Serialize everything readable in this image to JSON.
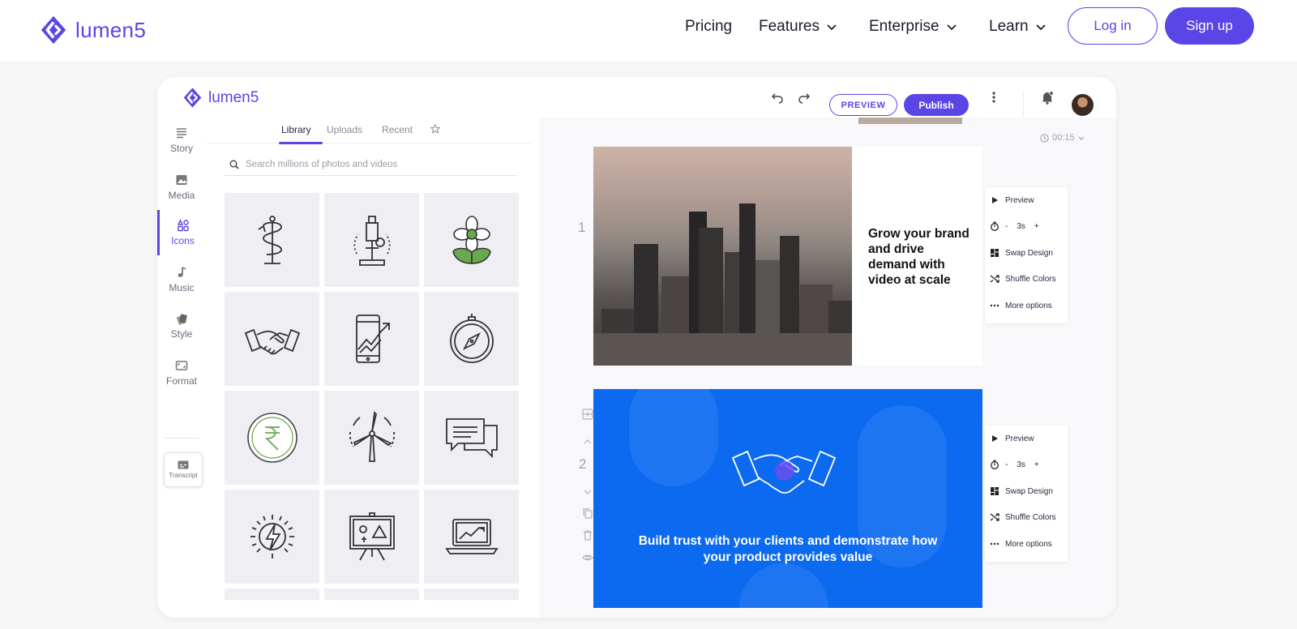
{
  "site": {
    "logo_text": "lumen5",
    "nav": [
      {
        "label": "Pricing",
        "has_dropdown": false
      },
      {
        "label": "Features",
        "has_dropdown": true
      },
      {
        "label": "Enterprise",
        "has_dropdown": true
      },
      {
        "label": "Learn",
        "has_dropdown": true
      }
    ],
    "login_label": "Log in",
    "signup_label": "Sign up",
    "accent_color": "#5a46e6"
  },
  "app": {
    "logo_text": "lumen5",
    "toolbar": {
      "undo_icon": "undo-icon",
      "redo_icon": "redo-icon",
      "preview_label": "PREVIEW",
      "publish_label": "Publish",
      "more_icon": "kebab-menu-icon",
      "notification_icon": "bell-icon"
    },
    "rail": [
      {
        "label": "Story",
        "icon": "lines-icon",
        "active": false
      },
      {
        "label": "Media",
        "icon": "image-icon",
        "active": false
      },
      {
        "label": "Icons",
        "icon": "shapes-icon",
        "active": true
      },
      {
        "label": "Music",
        "icon": "music-note-icon",
        "active": false
      },
      {
        "label": "Style",
        "icon": "palette-icon",
        "active": false
      },
      {
        "label": "Format",
        "icon": "aspect-ratio-icon",
        "active": false
      }
    ],
    "transcript_label": "Transcript",
    "panel": {
      "tabs": [
        "Library",
        "Uploads",
        "Recent"
      ],
      "active_tab": "Library",
      "favorites_icon": "star-icon",
      "search_placeholder": "Search millions of photos and videos",
      "icons": [
        "caduceus-icon",
        "microscope-icon",
        "flower-icon",
        "handshake-icon",
        "phone-growth-chart-icon",
        "compass-icon",
        "rupee-coin-icon",
        "wind-turbine-icon",
        "chat-bubbles-icon",
        "energy-bolt-icon",
        "presentation-board-icon",
        "laptop-chart-icon"
      ]
    },
    "canvas": {
      "duration": "00:15",
      "scenes": [
        {
          "number": "1",
          "text": "Grow your brand and drive demand with video at scale"
        },
        {
          "number": "2",
          "text": "Build trust with your clients and demonstrate how your product provides value"
        }
      ],
      "scene_menu": {
        "preview": "Preview",
        "minus": "-",
        "duration": "3s",
        "plus": "+",
        "swap_design": "Swap Design",
        "shuffle_colors": "Shuffle Colors",
        "more_options": "More options"
      },
      "scene2_bg": "#0b6af0"
    }
  }
}
